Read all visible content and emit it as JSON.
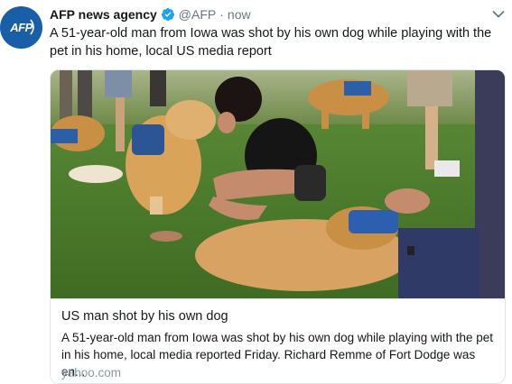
{
  "tweet": {
    "author_name": "AFP news agency",
    "handle": "@AFP",
    "separator": "·",
    "time": "now",
    "text": "A 51-year-old man from Iowa was shot by his own dog while playing with the pet in his home, local US media report",
    "avatar_label": "AFP"
  },
  "card": {
    "title": "US man shot by his own dog",
    "description": "A 51-year-old man from Iowa was shot by his own dog while playing with the pet in his home, local media reported Friday. Richard Remme of Fort Dodge was en...",
    "domain": "yahoo.com"
  },
  "icons": {
    "verified": "verified-badge-icon",
    "caret": "chevron-down-icon"
  },
  "colors": {
    "verified_blue": "#1da1f2",
    "avatar_blue": "#1a5ea8",
    "secondary_text": "#657786"
  }
}
